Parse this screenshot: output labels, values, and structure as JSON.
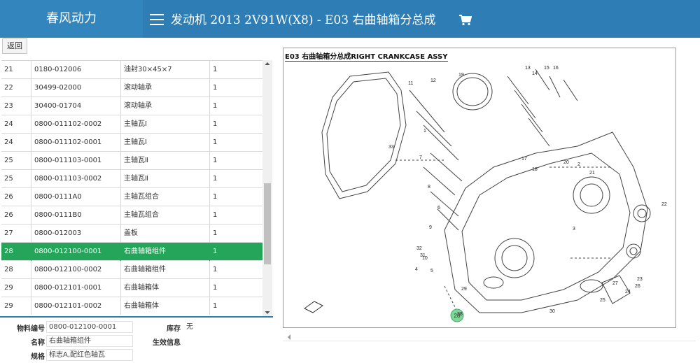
{
  "header": {
    "brand": "春风动力",
    "title": "发动机 2013 2V91W(X8) - E03 右曲轴箱分总成"
  },
  "toolbar": {
    "back_label": "返回"
  },
  "parts_table": {
    "rows": [
      {
        "no": "21",
        "part_no": "0180-012006",
        "name": "油封30×45×7",
        "qty": "1"
      },
      {
        "no": "22",
        "part_no": "30499-02000",
        "name": "滚动轴承",
        "qty": "1"
      },
      {
        "no": "23",
        "part_no": "30400-01704",
        "name": "滚动轴承",
        "qty": "1"
      },
      {
        "no": "24",
        "part_no": "0800-011102-0002",
        "name": "主轴瓦Ⅰ",
        "qty": "1"
      },
      {
        "no": "24",
        "part_no": "0800-011102-0001",
        "name": "主轴瓦Ⅰ",
        "qty": "1"
      },
      {
        "no": "25",
        "part_no": "0800-011103-0001",
        "name": "主轴瓦Ⅱ",
        "qty": "1"
      },
      {
        "no": "25",
        "part_no": "0800-011103-0002",
        "name": "主轴瓦Ⅱ",
        "qty": "1"
      },
      {
        "no": "26",
        "part_no": "0800-0111A0",
        "name": "主轴瓦组合",
        "qty": "1"
      },
      {
        "no": "26",
        "part_no": "0800-0111B0",
        "name": "主轴瓦组合",
        "qty": "1"
      },
      {
        "no": "27",
        "part_no": "0800-012003",
        "name": "盖板",
        "qty": "1"
      },
      {
        "no": "28",
        "part_no": "0800-012100-0001",
        "name": "右曲轴箱组件",
        "qty": "1",
        "selected": true
      },
      {
        "no": "28",
        "part_no": "0800-012100-0002",
        "name": "右曲轴箱组件",
        "qty": "1"
      },
      {
        "no": "29",
        "part_no": "0800-012101-0001",
        "name": "右曲轴箱体",
        "qty": "1"
      },
      {
        "no": "29",
        "part_no": "0800-012101-0002",
        "name": "右曲轴箱体",
        "qty": "1"
      }
    ]
  },
  "detail": {
    "part_no_label": "物料编号",
    "part_no_value": "0800-012100-0001",
    "stock_label": "库存",
    "stock_value": "无",
    "name_label": "名称",
    "name_value": "右曲轴箱组件",
    "effective_label": "生效信息",
    "effective_value": "",
    "spec_label": "规格",
    "spec_value": "标志A,配红色轴瓦"
  },
  "diagram": {
    "title": "E03 右曲轴箱分总成RIGHT CRANKCASE ASSY",
    "highlight_label": "28",
    "callouts": [
      "1",
      "11",
      "12",
      "13",
      "14",
      "15",
      "16",
      "17",
      "18",
      "19",
      "2",
      "20",
      "21",
      "22",
      "23",
      "24",
      "25",
      "26",
      "27",
      "28",
      "29",
      "3",
      "30",
      "31",
      "32",
      "33",
      "4",
      "5",
      "6",
      "7",
      "8",
      "9",
      "10"
    ]
  },
  "colors": {
    "header_bg": "#2e7eb5",
    "selected_row": "#25a559",
    "highlight_marker": "#7fd49a"
  }
}
